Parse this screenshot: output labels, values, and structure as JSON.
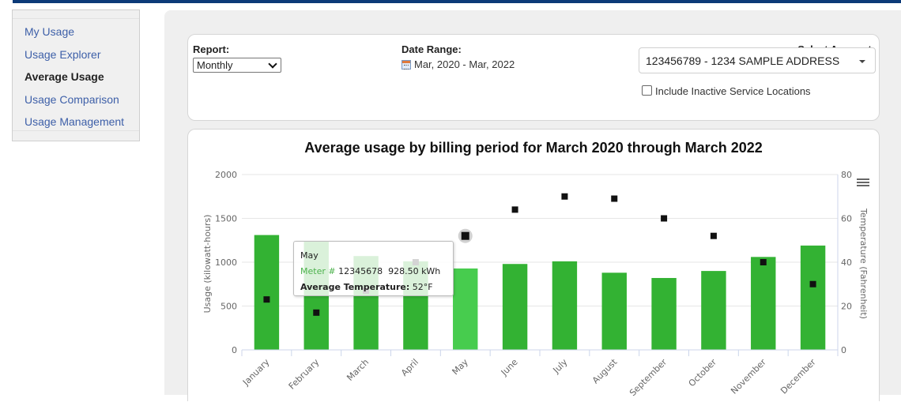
{
  "sidebar": {
    "items": [
      {
        "label": "My Usage",
        "active": false
      },
      {
        "label": "Usage Explorer",
        "active": false
      },
      {
        "label": "Average Usage",
        "active": true
      },
      {
        "label": "Usage Comparison",
        "active": false
      },
      {
        "label": "Usage Management",
        "active": false
      }
    ]
  },
  "filters": {
    "report_label": "Report:",
    "report_value": "Monthly",
    "date_range_label": "Date Range:",
    "date_range_value": "Mar, 2020 - Mar, 2022",
    "date_range_icon": "calendar-icon",
    "account_label": "Select Account:",
    "account_value": "123456789 - 1234 SAMPLE ADDRESS",
    "include_inactive_label": "Include Inactive Service Locations",
    "include_inactive_checked": false
  },
  "colors": {
    "bar": "#33b233",
    "bar_highlight": "#47cc4e",
    "line": "#111111",
    "nav_link": "#3d5fa8",
    "header_bar": "#0c3a78"
  },
  "tooltip": {
    "month": "May",
    "meter_label": "Meter #",
    "meter_number": "12345678",
    "usage": "928.50 kWh",
    "temp_label": "Average Temperature:",
    "temp_value": "52°F"
  },
  "chart_data": {
    "type": "bar",
    "title": "Average usage by billing period for March 2020 through March 2022",
    "categories": [
      "January",
      "February",
      "March",
      "April",
      "May",
      "June",
      "July",
      "August",
      "September",
      "October",
      "November",
      "December"
    ],
    "series": [
      {
        "name": "Usage",
        "type": "bar",
        "axis": "left",
        "values": [
          1310,
          1240,
          1070,
          1010,
          928.5,
          980,
          1010,
          880,
          820,
          900,
          1060,
          1190
        ]
      },
      {
        "name": "Average Temperature",
        "type": "line",
        "axis": "right",
        "values": [
          23,
          17,
          27,
          40,
          52,
          64,
          70,
          69,
          60,
          52,
          40,
          30
        ]
      }
    ],
    "ylabel": "Usage (kilowatt-hours)",
    "ylim": [
      0,
      2000
    ],
    "yticks": [
      0,
      500,
      1000,
      1500,
      2000
    ],
    "y2label": "Temperature (Fahrenheit)",
    "y2lim": [
      0,
      80
    ],
    "y2ticks": [
      0,
      20,
      40,
      60,
      80
    ],
    "highlighted_category": "May",
    "grid": true,
    "legend": "none"
  }
}
